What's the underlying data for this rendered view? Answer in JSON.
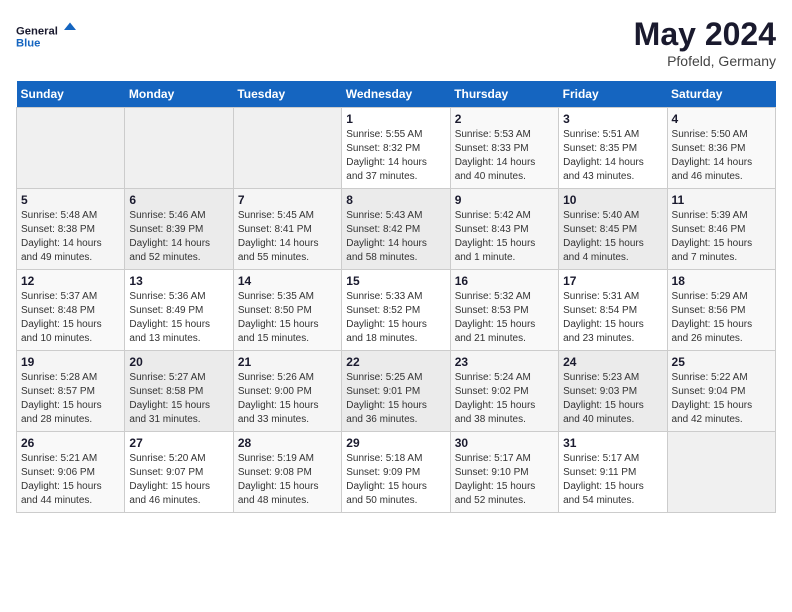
{
  "header": {
    "logo_line1": "General",
    "logo_line2": "Blue",
    "title": "May 2024",
    "subtitle": "Pfofeld, Germany"
  },
  "columns": [
    "Sunday",
    "Monday",
    "Tuesday",
    "Wednesday",
    "Thursday",
    "Friday",
    "Saturday"
  ],
  "weeks": [
    {
      "days": [
        {
          "num": "",
          "info": ""
        },
        {
          "num": "",
          "info": ""
        },
        {
          "num": "",
          "info": ""
        },
        {
          "num": "1",
          "info": "Sunrise: 5:55 AM\nSunset: 8:32 PM\nDaylight: 14 hours\nand 37 minutes."
        },
        {
          "num": "2",
          "info": "Sunrise: 5:53 AM\nSunset: 8:33 PM\nDaylight: 14 hours\nand 40 minutes."
        },
        {
          "num": "3",
          "info": "Sunrise: 5:51 AM\nSunset: 8:35 PM\nDaylight: 14 hours\nand 43 minutes."
        },
        {
          "num": "4",
          "info": "Sunrise: 5:50 AM\nSunset: 8:36 PM\nDaylight: 14 hours\nand 46 minutes."
        }
      ]
    },
    {
      "days": [
        {
          "num": "5",
          "info": "Sunrise: 5:48 AM\nSunset: 8:38 PM\nDaylight: 14 hours\nand 49 minutes."
        },
        {
          "num": "6",
          "info": "Sunrise: 5:46 AM\nSunset: 8:39 PM\nDaylight: 14 hours\nand 52 minutes."
        },
        {
          "num": "7",
          "info": "Sunrise: 5:45 AM\nSunset: 8:41 PM\nDaylight: 14 hours\nand 55 minutes."
        },
        {
          "num": "8",
          "info": "Sunrise: 5:43 AM\nSunset: 8:42 PM\nDaylight: 14 hours\nand 58 minutes."
        },
        {
          "num": "9",
          "info": "Sunrise: 5:42 AM\nSunset: 8:43 PM\nDaylight: 15 hours\nand 1 minute."
        },
        {
          "num": "10",
          "info": "Sunrise: 5:40 AM\nSunset: 8:45 PM\nDaylight: 15 hours\nand 4 minutes."
        },
        {
          "num": "11",
          "info": "Sunrise: 5:39 AM\nSunset: 8:46 PM\nDaylight: 15 hours\nand 7 minutes."
        }
      ]
    },
    {
      "days": [
        {
          "num": "12",
          "info": "Sunrise: 5:37 AM\nSunset: 8:48 PM\nDaylight: 15 hours\nand 10 minutes."
        },
        {
          "num": "13",
          "info": "Sunrise: 5:36 AM\nSunset: 8:49 PM\nDaylight: 15 hours\nand 13 minutes."
        },
        {
          "num": "14",
          "info": "Sunrise: 5:35 AM\nSunset: 8:50 PM\nDaylight: 15 hours\nand 15 minutes."
        },
        {
          "num": "15",
          "info": "Sunrise: 5:33 AM\nSunset: 8:52 PM\nDaylight: 15 hours\nand 18 minutes."
        },
        {
          "num": "16",
          "info": "Sunrise: 5:32 AM\nSunset: 8:53 PM\nDaylight: 15 hours\nand 21 minutes."
        },
        {
          "num": "17",
          "info": "Sunrise: 5:31 AM\nSunset: 8:54 PM\nDaylight: 15 hours\nand 23 minutes."
        },
        {
          "num": "18",
          "info": "Sunrise: 5:29 AM\nSunset: 8:56 PM\nDaylight: 15 hours\nand 26 minutes."
        }
      ]
    },
    {
      "days": [
        {
          "num": "19",
          "info": "Sunrise: 5:28 AM\nSunset: 8:57 PM\nDaylight: 15 hours\nand 28 minutes."
        },
        {
          "num": "20",
          "info": "Sunrise: 5:27 AM\nSunset: 8:58 PM\nDaylight: 15 hours\nand 31 minutes."
        },
        {
          "num": "21",
          "info": "Sunrise: 5:26 AM\nSunset: 9:00 PM\nDaylight: 15 hours\nand 33 minutes."
        },
        {
          "num": "22",
          "info": "Sunrise: 5:25 AM\nSunset: 9:01 PM\nDaylight: 15 hours\nand 36 minutes."
        },
        {
          "num": "23",
          "info": "Sunrise: 5:24 AM\nSunset: 9:02 PM\nDaylight: 15 hours\nand 38 minutes."
        },
        {
          "num": "24",
          "info": "Sunrise: 5:23 AM\nSunset: 9:03 PM\nDaylight: 15 hours\nand 40 minutes."
        },
        {
          "num": "25",
          "info": "Sunrise: 5:22 AM\nSunset: 9:04 PM\nDaylight: 15 hours\nand 42 minutes."
        }
      ]
    },
    {
      "days": [
        {
          "num": "26",
          "info": "Sunrise: 5:21 AM\nSunset: 9:06 PM\nDaylight: 15 hours\nand 44 minutes."
        },
        {
          "num": "27",
          "info": "Sunrise: 5:20 AM\nSunset: 9:07 PM\nDaylight: 15 hours\nand 46 minutes."
        },
        {
          "num": "28",
          "info": "Sunrise: 5:19 AM\nSunset: 9:08 PM\nDaylight: 15 hours\nand 48 minutes."
        },
        {
          "num": "29",
          "info": "Sunrise: 5:18 AM\nSunset: 9:09 PM\nDaylight: 15 hours\nand 50 minutes."
        },
        {
          "num": "30",
          "info": "Sunrise: 5:17 AM\nSunset: 9:10 PM\nDaylight: 15 hours\nand 52 minutes."
        },
        {
          "num": "31",
          "info": "Sunrise: 5:17 AM\nSunset: 9:11 PM\nDaylight: 15 hours\nand 54 minutes."
        },
        {
          "num": "",
          "info": ""
        }
      ]
    }
  ]
}
